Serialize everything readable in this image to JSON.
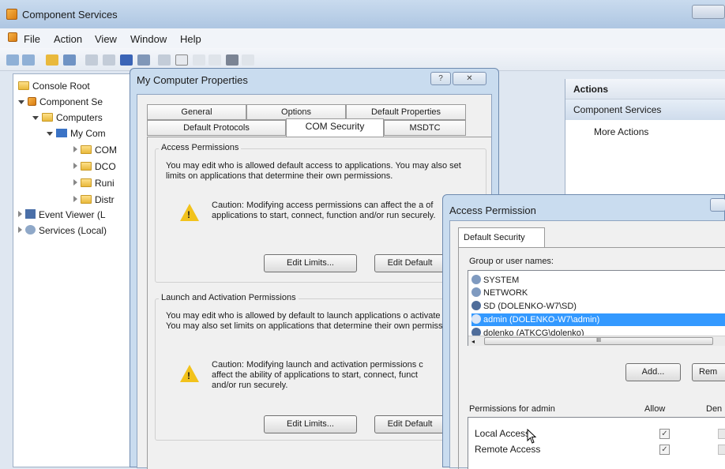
{
  "app": {
    "title": "Component Services"
  },
  "menu": [
    "File",
    "Action",
    "View",
    "Window",
    "Help"
  ],
  "tree": {
    "items": [
      "Console Root",
      "Component Se",
      "Computers",
      "My Com",
      "COM",
      "DCO",
      "Runi",
      "Distr",
      "Event Viewer (L",
      "Services (Local)"
    ]
  },
  "actions": {
    "header": "Actions",
    "section": "Component Services",
    "more": "More Actions"
  },
  "props": {
    "title": "My Computer Properties",
    "help": "?",
    "close": "✕",
    "tabs_row1": [
      "General",
      "Options",
      "Default Properties"
    ],
    "tabs_row2": [
      "Default Protocols",
      "COM Security",
      "MSDTC"
    ],
    "access": {
      "label": "Access Permissions",
      "desc": "You may edit who is allowed default access to applications. You may also set limits on applications that determine their own permissions.",
      "caution": "Caution: Modifying access permissions can affect the a of applications to start, connect, function and/or run securely.",
      "edit_limits": "Edit Limits...",
      "edit_default": "Edit Default"
    },
    "launch": {
      "label": "Launch and Activation Permissions",
      "desc": "You may edit who is allowed by default to launch applications o activate objects. You may also set limits on applications that determine their own permissions.",
      "caution": "Caution: Modifying launch and activation permissions c affect the ability of applications to start, connect, funct and/or run securely.",
      "edit_limits": "Edit Limits...",
      "edit_default": "Edit Default"
    }
  },
  "access_perm": {
    "title": "Access Permission",
    "tab": "Default Security",
    "group_label": "Group or user names:",
    "users": [
      {
        "name": "SYSTEM",
        "selected": false
      },
      {
        "name": "NETWORK",
        "selected": false
      },
      {
        "name": "SD (DOLENKO-W7\\SD)",
        "selected": false
      },
      {
        "name": "admin (DOLENKO-W7\\admin)",
        "selected": true
      },
      {
        "name": "dolenko (ATKCG\\dolenko)",
        "selected": false
      }
    ],
    "scroll_grip": "III",
    "add": "Add...",
    "remove": "Rem",
    "perm_label": "Permissions for admin",
    "allow": "Allow",
    "deny": "Den",
    "perms": [
      {
        "name": "Local Access",
        "allow": true,
        "deny": false
      },
      {
        "name": "Remote Access",
        "allow": true,
        "deny": false
      }
    ]
  }
}
